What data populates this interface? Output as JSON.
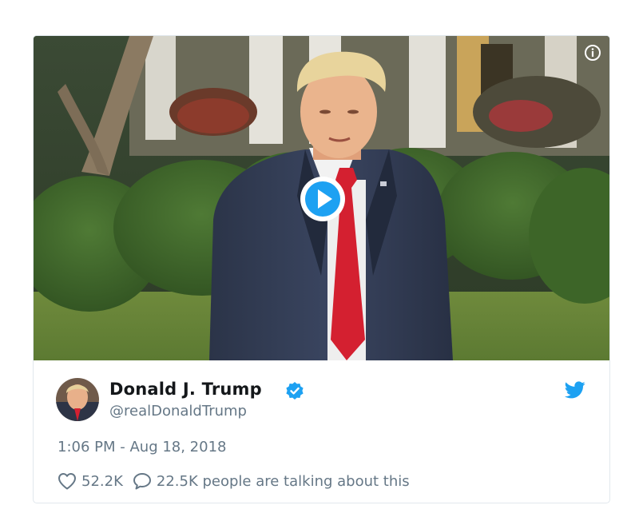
{
  "tweet": {
    "author_name": "Donald J. Trump",
    "handle": "@realDonaldTrump",
    "timestamp": "1:06 PM - Aug 18, 2018",
    "likes": "52.2K",
    "replies_text": "22.5K people are talking about this"
  },
  "icons": {
    "info": "info-icon",
    "play": "play-icon",
    "verified": "verified-badge-icon",
    "brand": "twitter-bird-icon",
    "like": "heart-icon",
    "reply": "speech-bubble-icon"
  },
  "colors": {
    "twitter_blue": "#1da1f2",
    "text_primary": "#14171a",
    "text_secondary": "#657786",
    "border": "#e1e8ed"
  }
}
